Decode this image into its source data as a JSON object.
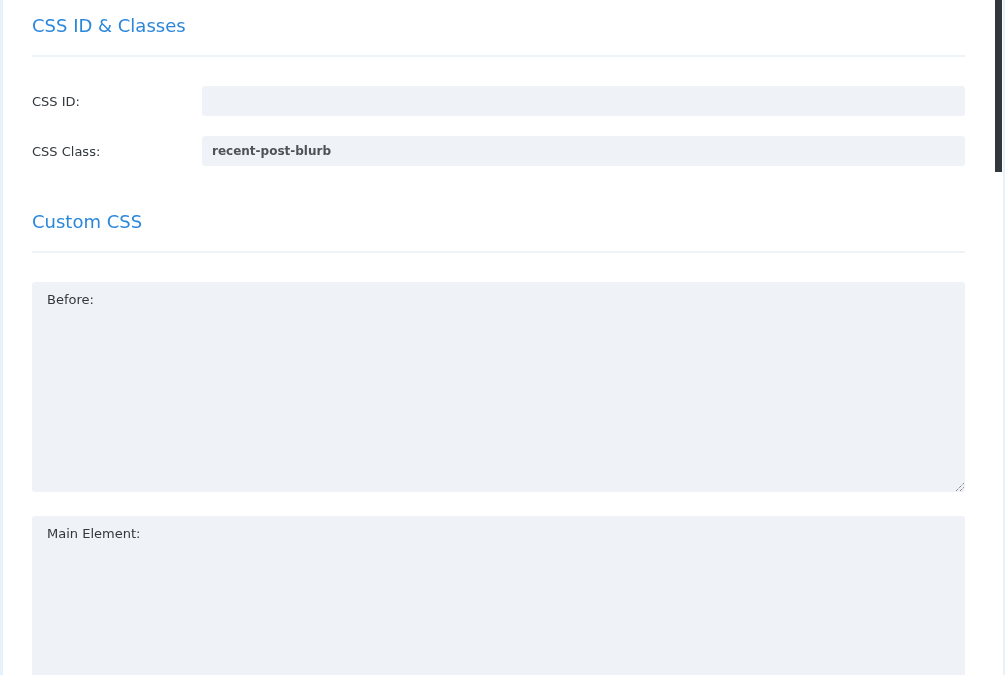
{
  "sections": [
    {
      "title": "CSS ID & Classes",
      "kind": "inputs",
      "fields": [
        {
          "label": "CSS ID:"
        },
        {
          "label": "CSS Class:",
          "value": "recent-post-blurb"
        }
      ]
    },
    {
      "title": "Custom CSS",
      "kind": "textareas",
      "fields": [
        {
          "label": "Before:"
        },
        {
          "label": "Main Element:"
        }
      ]
    }
  ]
}
